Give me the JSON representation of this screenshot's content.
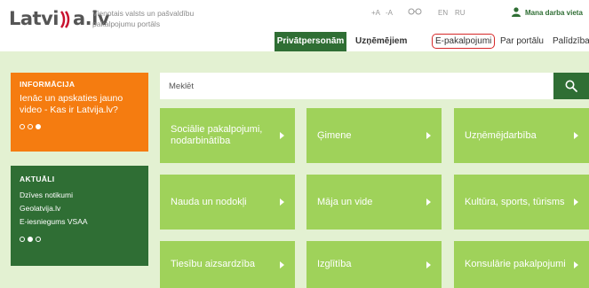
{
  "header": {
    "logo_left": "Latvi",
    "logo_right": "a.lv",
    "tagline": "Vienotais valsts un pašvaldību pakalpojumu portāls",
    "utils": {
      "font_plus": "+A",
      "font_minus": "-A",
      "lang_en": "EN",
      "lang_ru": "RU",
      "my_work": "Mana darba vieta"
    }
  },
  "nav": {
    "private": "Privātpersonām",
    "business": "Uzņēmējiem",
    "eservices": "E-pakalpojumi",
    "portal": "Par portālu",
    "help": "Palīdzība"
  },
  "info": {
    "title": "INFORMĀCIJA",
    "text": "Ienāc un apskaties jauno video - Kas ir Latvija.lv?",
    "active_slide": 3,
    "slide_count": 3
  },
  "news": {
    "title": "AKTUĀLI",
    "items": [
      "Dzīves notikumi",
      "Geolatvija.lv",
      "E-iesniegums VSAA"
    ],
    "active_slide": 2,
    "slide_count": 3
  },
  "search": {
    "placeholder": "Meklēt"
  },
  "tiles": [
    "Sociālie pakalpojumi, nodarbinātība",
    "Ģimene",
    "Uzņēmējdarbība",
    "Nauda un nodokļi",
    "Māja un vide",
    "Kultūra, sports, tūrisms",
    "Tiesību aizsardzība",
    "Izglītība",
    "Konsulārie pakalpojumi"
  ],
  "colors": {
    "brand_green": "#2f6e34",
    "tile_green": "#9fd25a",
    "background_green": "#e3f1d2",
    "info_orange": "#f57c10",
    "highlight_red": "#d62828"
  },
  "icons": [
    "search-icon",
    "user-icon",
    "accessibility-icon",
    "arrow-right-icon"
  ]
}
